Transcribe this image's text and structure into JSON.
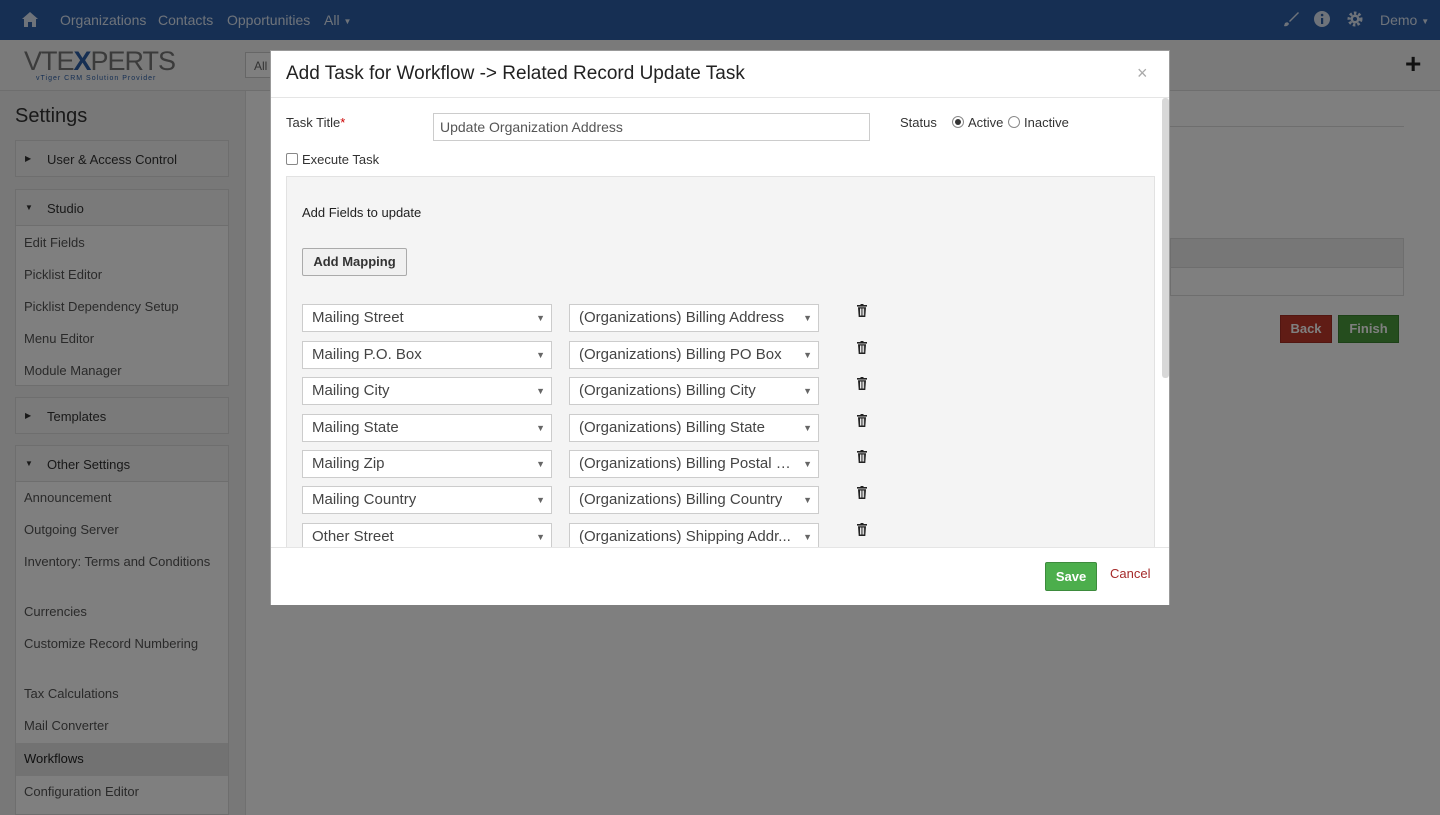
{
  "topnav": {
    "items": [
      "Organizations",
      "Contacts",
      "Opportunities",
      "All"
    ],
    "user": "Demo"
  },
  "logo": {
    "text_left": "VTE",
    "text_x": "X",
    "text_right": "PERTS",
    "tagline": "vTiger CRM Solution Provider"
  },
  "filter_all": "All",
  "sidebar": {
    "title": "Settings",
    "sections": {
      "user_access": "User & Access Control",
      "studio": "Studio",
      "templates": "Templates",
      "other": "Other Settings"
    },
    "studio_items": [
      "Edit Fields",
      "Picklist Editor",
      "Picklist Dependency Setup",
      "Menu Editor",
      "Module Manager"
    ],
    "other_items": [
      "Announcement",
      "Outgoing Server",
      "Inventory: Terms and Conditions",
      "Currencies",
      "Customize Record Numbering",
      "Tax Calculations",
      "Mail Converter"
    ],
    "active_item": "Workflows",
    "after_active": "Configuration Editor"
  },
  "background": {
    "back": "Back",
    "finish": "Finish"
  },
  "modal": {
    "title": "Add Task for Workflow -> Related Record Update Task",
    "close": "×",
    "task_title_label": "Task Title",
    "required_mark": "*",
    "task_title_value": "Update Organization Address",
    "status_label": "Status",
    "status_active": "Active",
    "status_inactive": "Inactive",
    "status_selected": "Active",
    "execute_task": "Execute Task",
    "fields_heading": "Add Fields to update",
    "add_mapping": "Add Mapping",
    "mappings": [
      {
        "source": "Mailing Street",
        "target": "(Organizations) Billing Address"
      },
      {
        "source": "Mailing P.O. Box",
        "target": "(Organizations) Billing PO Box"
      },
      {
        "source": "Mailing City",
        "target": "(Organizations) Billing City"
      },
      {
        "source": "Mailing State",
        "target": "(Organizations) Billing State"
      },
      {
        "source": "Mailing Zip",
        "target": "(Organizations) Billing Postal C..."
      },
      {
        "source": "Mailing Country",
        "target": "(Organizations) Billing Country"
      },
      {
        "source": "Other Street",
        "target": "(Organizations) Shipping Addr..."
      }
    ],
    "save": "Save",
    "cancel": "Cancel"
  },
  "colors": {
    "navbar": "#2c5fa7",
    "save": "#4cae4c",
    "back": "#c0392b",
    "finish": "#4a9b3c"
  }
}
